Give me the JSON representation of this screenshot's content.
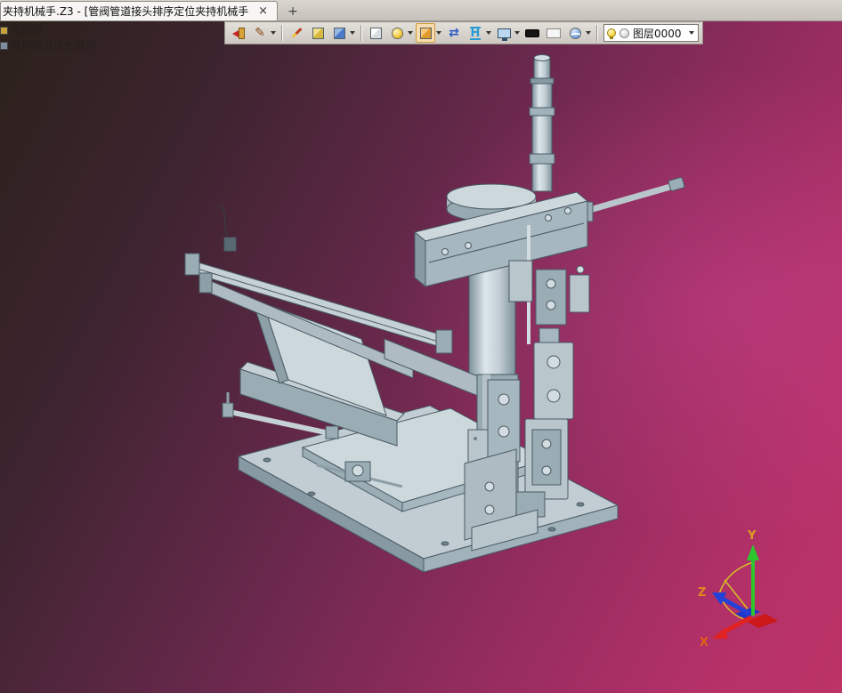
{
  "window": {
    "tab_title": "夹持机械手.Z3 - [管阀管道接头排序定位夹持机械手]",
    "close_glyph": "×",
    "new_tab_glyph": "+"
  },
  "hints": {
    "line1": "变热键",
    "line2": "鼠标取消这些提示."
  },
  "toolbar": {
    "layer_label": "图层0000",
    "pen_glyph": "✎",
    "swap_glyph": "⇄",
    "beam_glyph": "H",
    "icons": [
      "exit-icon",
      "pen-icon",
      "brush-icon",
      "cube-yellow-icon",
      "cube-blue-icon",
      "cube-white-icon",
      "sphere-yellow-icon",
      "cube-orange-icon",
      "swap-arrows-icon",
      "beam-section-icon",
      "monitor-icon",
      "zebra-stripe-icon",
      "white-panel-icon",
      "sphere-swoosh-icon",
      "bulb-icon",
      "layer-circle-icon"
    ]
  },
  "viewport": {
    "background_dark": "#2b211b",
    "background_magenta": "#b43168",
    "model_color": "#b9c6cc"
  },
  "triad": {
    "x_label": "X",
    "y_label": "Y",
    "z_label": "Z",
    "x_color": "#e02222",
    "y_color": "#2ec62e",
    "z_color": "#2440d8",
    "label_color": "#e08a1a"
  }
}
